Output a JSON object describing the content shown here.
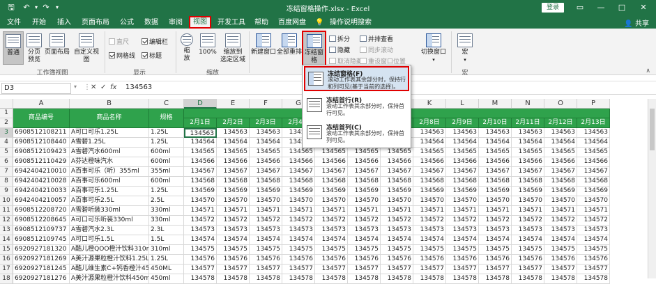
{
  "title_bar": {
    "title": "冻结窗格操作.xlsx  -  Excel",
    "login_label": "登录",
    "save_icon": "save-icon",
    "undo_icon": "undo-icon",
    "redo_icon": "redo-icon",
    "minimize": "—",
    "restore": "□",
    "close": "✕",
    "ribbon_opts": "▭"
  },
  "tabs": [
    {
      "label": "文件"
    },
    {
      "label": "开始"
    },
    {
      "label": "插入"
    },
    {
      "label": "页面布局"
    },
    {
      "label": "公式"
    },
    {
      "label": "数据"
    },
    {
      "label": "审阅"
    },
    {
      "label": "视图"
    },
    {
      "label": "开发工具"
    },
    {
      "label": "帮助"
    },
    {
      "label": "百度网盘"
    },
    {
      "label": "操作说明搜索"
    }
  ],
  "share": "共享",
  "ribbon": {
    "workbook_views": {
      "normal": "普通",
      "page_break": "分页\n预览",
      "page_layout": "页面布局",
      "custom": "自定义视图",
      "group_label": "工作簿视图"
    },
    "show": {
      "ruler": "直尺",
      "formula_bar": "编辑栏",
      "gridlines": "网格线",
      "headings": "标题",
      "group_label": "显示"
    },
    "zoom": {
      "zoom": "缩\n放",
      "hundred": "100%",
      "zoom_sel": "缩放到\n选定区域",
      "group_label": "缩放"
    },
    "window": {
      "new_window": "新建窗口",
      "arrange_all": "全部重排",
      "freeze_panes": "冻结窗格",
      "split": "拆分",
      "hide": "隐藏",
      "unhide": "取消隐藏",
      "side_by_side": "并排查看",
      "sync_scroll": "同步滚动",
      "reset_pos": "重设窗口位置",
      "switch": "切换窗口"
    },
    "macros": {
      "label": "宏",
      "group_label": "宏"
    }
  },
  "formula_bar": {
    "name_box": "D3",
    "cancel": "✕",
    "enter": "✓",
    "fx": "fx",
    "value": "134563"
  },
  "menu": [
    {
      "title": "冻结窗格(F)",
      "desc": "滚动工作表其余部分时，保持行和列可见(基于当前的选择)。"
    },
    {
      "title": "冻结首行(R)",
      "desc": "滚动工作表其余部分时，保持首行可见。"
    },
    {
      "title": "冻结首列(C)",
      "desc": "滚动工作表其余部分时，保持首列可见。"
    }
  ],
  "columns": [
    "A",
    "B",
    "C",
    "D",
    "E",
    "F",
    "G",
    "H",
    "I",
    "J",
    "K",
    "L",
    "M",
    "N",
    "O",
    "P"
  ],
  "header_row": {
    "a": "商品编号",
    "b": "商品名称",
    "c": "规格",
    "dates": [
      "2月1日",
      "2月2日",
      "2月3日",
      "2月4日",
      "2月5日",
      "2月6日",
      "2月7日",
      "2月8日",
      "2月9日",
      "2月10日",
      "2月11日",
      "2月12日",
      "2月13日"
    ]
  },
  "rows": [
    {
      "n": "1",
      "a": "",
      "b": "",
      "c": ""
    },
    {
      "n": "2",
      "a": "",
      "b": "",
      "c": ""
    },
    {
      "n": "3",
      "a": "6908512108211",
      "b": "A可口可乐1.25L",
      "c": "1.25L",
      "v": "134563"
    },
    {
      "n": "4",
      "a": "6908512108440",
      "b": "A雪碧1.25L",
      "c": "1.25L",
      "v": "134564"
    },
    {
      "n": "5",
      "a": "6908512109423",
      "b": "A雪碧汽水600ml",
      "c": "600ml",
      "v": "134565"
    },
    {
      "n": "6",
      "a": "6908512110429",
      "b": "A芬达橙味汽水",
      "c": "600ml",
      "v": "134566"
    },
    {
      "n": "7",
      "a": "6942404210010",
      "b": "A百事可乐（听）355ml",
      "c": "355ml",
      "v": "134567"
    },
    {
      "n": "8",
      "a": "6942404210028",
      "b": "A百事可乐600ml",
      "c": "600ml",
      "v": "134568"
    },
    {
      "n": "9",
      "a": "6942404210033",
      "b": "A百事可乐1.25L",
      "c": "1.25L",
      "v": "134569"
    },
    {
      "n": "10",
      "a": "6942404210057",
      "b": "A百事可乐2.5L",
      "c": "2.5L",
      "v": "134570"
    },
    {
      "n": "11",
      "a": "6908512208720",
      "b": "A雪碧听装330ml",
      "c": "330ml",
      "v": "134571"
    },
    {
      "n": "12",
      "a": "6908512208645",
      "b": "A可口可乐听装330ml",
      "c": "330ml",
      "v": "134572"
    },
    {
      "n": "13",
      "a": "6908512109737",
      "b": "A雪碧汽水2.3L",
      "c": "2.3L",
      "v": "134573"
    },
    {
      "n": "14",
      "a": "6908512109745",
      "b": "A可口可乐1.5L",
      "c": "1.5L",
      "v": "134574"
    },
    {
      "n": "15",
      "a": "6920927181320",
      "b": "A酷儿橙QOO橙汁饮料310ml",
      "c": "310ml",
      "v": "134575"
    },
    {
      "n": "16",
      "a": "6920927181269",
      "b": "A美汁源果粒橙汁饮料1.25L",
      "c": "1.25L",
      "v": "134576"
    },
    {
      "n": "17",
      "a": "6920927181245",
      "b": "A酷儿维生素C+钙香橙汁450ml",
      "c": "450ML",
      "v": "134577"
    },
    {
      "n": "18",
      "a": "6920927181276",
      "b": "A美汁源果粒橙汁饮料450ml",
      "c": "450ml",
      "v": "134578"
    }
  ]
}
